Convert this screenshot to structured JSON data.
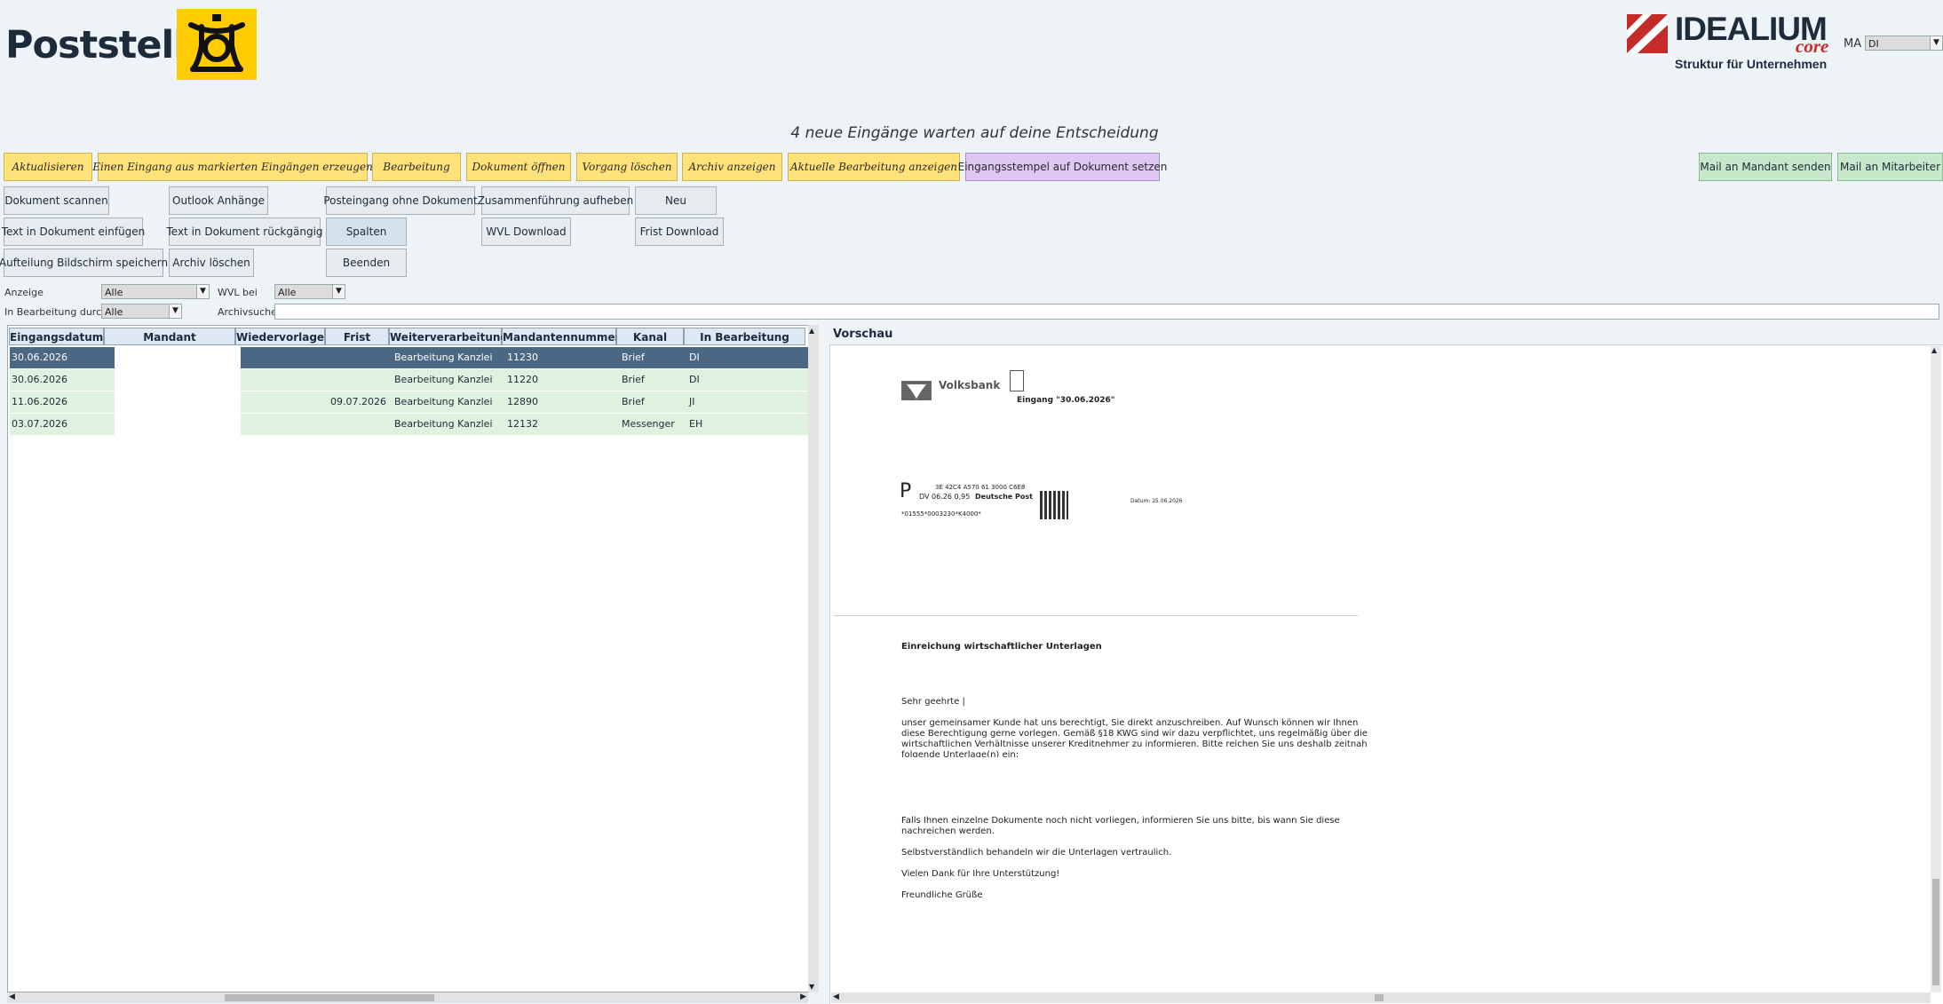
{
  "header": {
    "title": "Poststelle",
    "brand_name": "IDEALIUM",
    "brand_sub": "core",
    "brand_tagline": "Struktur für Unternehmen"
  },
  "user_select": {
    "label": "MA",
    "value": "DI"
  },
  "notice": "4 neue Eingänge warten auf deine Entscheidung",
  "toolbar_yellow": [
    "Aktualisieren",
    "Einen Eingang aus markierten Eingängen erzeugen",
    "Bearbeitung",
    "Dokument öffnen",
    "Vorgang löschen",
    "Archiv anzeigen",
    "Aktuelle Bearbeitung anzeigen"
  ],
  "toolbar_purple": "Eingangsstempel auf Dokument setzen",
  "toolbar_green": [
    "Mail an Mandant senden",
    "Mail an Mitarbeiter"
  ],
  "buttons": {
    "scan": "Dokument scannen",
    "outlook": "Outlook Anhänge",
    "posteingang": "Posteingang ohne Dokument",
    "merge_cancel": "Zusammenführung aufheben",
    "new": "Neu",
    "text_insert": "Text in Dokument einfügen",
    "text_undo": "Text in Dokument rückgängig",
    "columns": "Spalten",
    "wvl_download": "WVL Download",
    "frist_download": "Frist Download",
    "save_layout": "Aufteilung Bildschirm speichern",
    "archive_delete": "Archiv löschen",
    "quit": "Beenden"
  },
  "filters": {
    "anzeige_label": "Anzeige",
    "anzeige_value": "Alle",
    "wvl_label": "WVL bei",
    "wvl_value": "Alle",
    "inbearb_label": "In Bearbeitung durch",
    "inbearb_value": "Alle",
    "archiv_label": "Archivsuche",
    "archiv_value": ""
  },
  "table": {
    "columns": [
      "Eingangsdatum",
      "Mandant",
      "Wiedervorlage",
      "Frist",
      "Weiterverarbeitung",
      "Mandantennummer",
      "Kanal",
      "In Bearbeitung durch"
    ],
    "rows": [
      {
        "date": "30.06.2026",
        "mandant": "",
        "wv": "",
        "frist": "",
        "weiter": "Bearbeitung Kanzlei",
        "nr": "11230",
        "kanal": "Brief",
        "bearb": "DI",
        "selected": true
      },
      {
        "date": "30.06.2026",
        "mandant": "",
        "wv": "",
        "frist": "",
        "weiter": "Bearbeitung Kanzlei",
        "nr": "11220",
        "kanal": "Brief",
        "bearb": "DI",
        "selected": false
      },
      {
        "date": "11.06.2026",
        "mandant": "",
        "wv": "",
        "frist": "09.07.2026",
        "weiter": "Bearbeitung Kanzlei",
        "nr": "12890",
        "kanal": "Brief",
        "bearb": "JI",
        "selected": false
      },
      {
        "date": "03.07.2026",
        "mandant": "",
        "wv": "",
        "frist": "",
        "weiter": "Bearbeitung Kanzlei",
        "nr": "12132",
        "kanal": "Messenger",
        "bearb": "EH",
        "selected": false
      }
    ]
  },
  "preview": {
    "label": "Vorschau",
    "bank": "Volksbank",
    "stamp": "Eingang \"30.06.2026\"",
    "postal_code_line": "3E 42C4 A570 61 3000 C6E8",
    "dv": "DV 06.26  0,95",
    "deutsche_post": "Deutsche Post",
    "barcode_line": "*01555*0003230*K4000*",
    "datum": "Datum: 25.06.2026",
    "subject": "Einreichung wirtschaftlicher Unterlagen",
    "greeting": "Sehr geehrte |",
    "para1": [
      "unser gemeinsamer Kunde hat uns berechtigt, Sie direkt anzuschreiben. Auf Wunsch können wir Ihnen",
      "diese Berechtigung gerne vorlegen. Gemäß §18 KWG sind wir dazu verpflichtet, uns regelmäßig über die",
      "wirtschaftlichen Verhältnisse unserer Kreditnehmer zu informieren. Bitte reichen Sie uns deshalb zeitnah",
      "folgende Unterlage(n) ein:"
    ],
    "para2": [
      "Falls Ihnen einzelne Dokumente noch nicht vorliegen, informieren Sie uns bitte, bis wann Sie diese",
      "nachreichen werden."
    ],
    "para3": "Selbstverständlich behandeln wir die Unterlagen vertraulich.",
    "para4": "Vielen Dank für Ihre Unterstützung!",
    "closing": "Freundliche Grüße"
  },
  "colors": {
    "yellow": "#ffe27a",
    "purple": "#dcc8f3",
    "green": "#c8e8cb",
    "selected_row": "#4a6784",
    "row_bg": "#dff2df",
    "brand_red": "#c52b29"
  }
}
